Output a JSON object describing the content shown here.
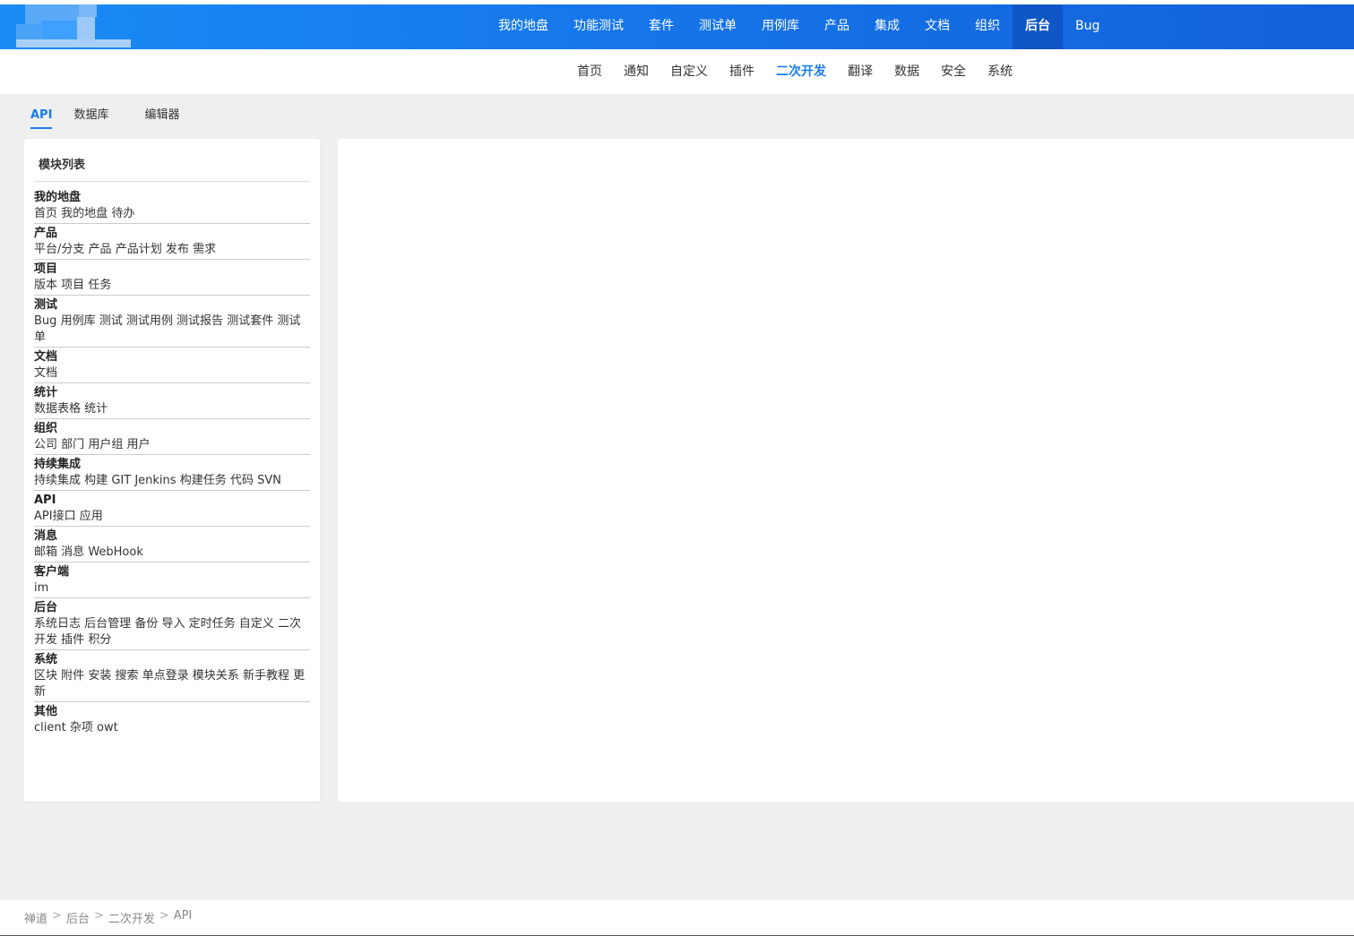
{
  "main_nav": [
    "我的地盘",
    "功能测试",
    "套件",
    "测试单",
    "用例库",
    "产品",
    "集成",
    "文档",
    "组织",
    "后台",
    "Bug"
  ],
  "main_nav_active": "后台",
  "sub_nav": [
    "首页",
    "通知",
    "自定义",
    "插件",
    "二次开发",
    "翻译",
    "数据",
    "安全",
    "系统"
  ],
  "sub_nav_active": "二次开发",
  "tabs": [
    "API",
    "数据库",
    "编辑器"
  ],
  "tab_active": "API",
  "module_panel": {
    "title": "模块列表",
    "groups": [
      {
        "title": "我的地盘",
        "links": [
          "首页",
          "我的地盘",
          "待办"
        ]
      },
      {
        "title": "产品",
        "links": [
          "平台/分支",
          "产品",
          "产品计划",
          "发布",
          "需求"
        ]
      },
      {
        "title": "项目",
        "links": [
          "版本",
          "项目",
          "任务"
        ]
      },
      {
        "title": "测试",
        "links": [
          "Bug",
          "用例库",
          "测试",
          "测试用例",
          "测试报告",
          "测试套件",
          "测试单"
        ]
      },
      {
        "title": "文档",
        "links": [
          "文档"
        ]
      },
      {
        "title": "统计",
        "links": [
          "数据表格",
          "统计"
        ]
      },
      {
        "title": "组织",
        "links": [
          "公司",
          "部门",
          "用户组",
          "用户"
        ]
      },
      {
        "title": "持续集成",
        "links": [
          "持续集成",
          "构建",
          "GIT",
          "Jenkins",
          "构建任务",
          "代码",
          "SVN"
        ]
      },
      {
        "title": "API",
        "links": [
          "API接口",
          "应用"
        ]
      },
      {
        "title": "消息",
        "links": [
          "邮箱",
          "消息",
          "WebHook"
        ]
      },
      {
        "title": "客户端",
        "links": [
          "im"
        ]
      },
      {
        "title": "后台",
        "links": [
          "系统日志",
          "后台管理",
          "备份",
          "导入",
          "定时任务",
          "自定义",
          "二次开发",
          "插件",
          "积分"
        ]
      },
      {
        "title": "系统",
        "links": [
          "区块",
          "附件",
          "安装",
          "搜索",
          "单点登录",
          "模块关系",
          "新手教程",
          "更新"
        ]
      },
      {
        "title": "其他",
        "links": [
          "client",
          "杂项",
          "owt"
        ]
      }
    ]
  },
  "breadcrumb": [
    "禅道",
    "后台",
    "二次开发",
    "API"
  ],
  "breadcrumb_separator": ">",
  "colors": {
    "topbar_start": "#1a8cf5",
    "topbar_end": "#1260da",
    "active_nav_bg": "#0f56c6",
    "accent": "#1a7bf0",
    "page_bg": "#efefef"
  }
}
